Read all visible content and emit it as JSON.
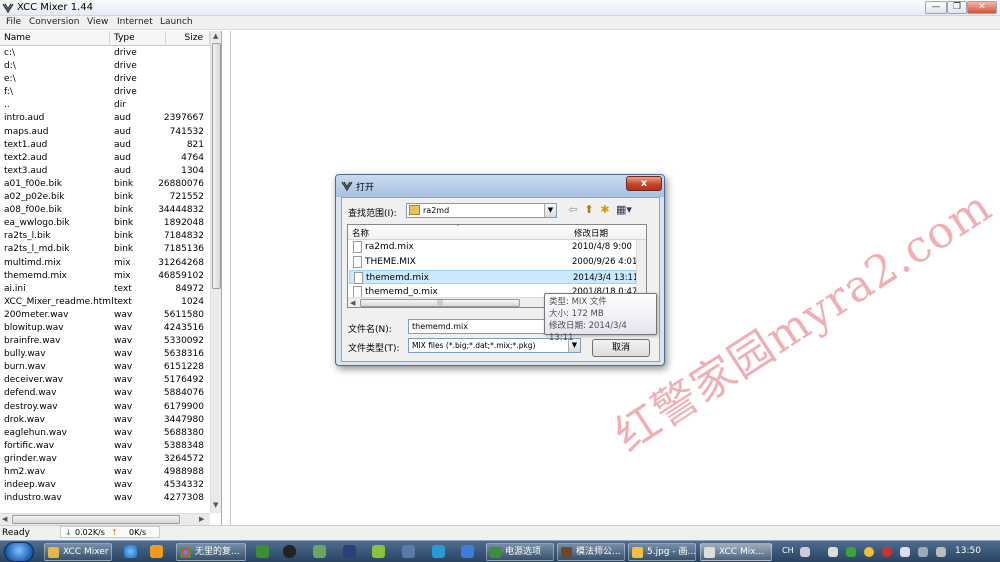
{
  "app": {
    "title": "XCC Mixer 1.44"
  },
  "window_controls": {
    "minimize": "—",
    "restore": "❐",
    "close": "✕"
  },
  "menu": [
    "File",
    "Conversion",
    "View",
    "Internet",
    "Launch"
  ],
  "list": {
    "headers": {
      "name": "Name",
      "type": "Type",
      "size": "Size"
    },
    "rows": [
      {
        "name": "c:\\",
        "type": "drive",
        "size": ""
      },
      {
        "name": "d:\\",
        "type": "drive",
        "size": ""
      },
      {
        "name": "e:\\",
        "type": "drive",
        "size": ""
      },
      {
        "name": "f:\\",
        "type": "drive",
        "size": ""
      },
      {
        "name": "..",
        "type": "dir",
        "size": ""
      },
      {
        "name": "intro.aud",
        "type": "aud",
        "size": "2397667"
      },
      {
        "name": "maps.aud",
        "type": "aud",
        "size": "741532"
      },
      {
        "name": "text1.aud",
        "type": "aud",
        "size": "821"
      },
      {
        "name": "text2.aud",
        "type": "aud",
        "size": "4764"
      },
      {
        "name": "text3.aud",
        "type": "aud",
        "size": "1304"
      },
      {
        "name": "a01_f00e.bik",
        "type": "bink",
        "size": "26880076"
      },
      {
        "name": "a02_p02e.bik",
        "type": "bink",
        "size": "721552"
      },
      {
        "name": "a08_f00e.bik",
        "type": "bink",
        "size": "34444832"
      },
      {
        "name": "ea_wwlogo.bik",
        "type": "bink",
        "size": "1892048"
      },
      {
        "name": "ra2ts_l.bik",
        "type": "bink",
        "size": "7184832"
      },
      {
        "name": "ra2ts_l_md.bik",
        "type": "bink",
        "size": "7185136"
      },
      {
        "name": "multimd.mix",
        "type": "mix",
        "size": "31264268"
      },
      {
        "name": "thememd.mix",
        "type": "mix",
        "size": "46859102"
      },
      {
        "name": "ai.ini",
        "type": "text",
        "size": "84972"
      },
      {
        "name": "XCC_Mixer_readme.html",
        "type": "text",
        "size": "1024"
      },
      {
        "name": "200meter.wav",
        "type": "wav",
        "size": "5611580"
      },
      {
        "name": "blowitup.wav",
        "type": "wav",
        "size": "4243516"
      },
      {
        "name": "brainfre.wav",
        "type": "wav",
        "size": "5330092"
      },
      {
        "name": "bully.wav",
        "type": "wav",
        "size": "5638316"
      },
      {
        "name": "burn.wav",
        "type": "wav",
        "size": "6151228"
      },
      {
        "name": "deceiver.wav",
        "type": "wav",
        "size": "5176492"
      },
      {
        "name": "defend.wav",
        "type": "wav",
        "size": "5884076"
      },
      {
        "name": "destroy.wav",
        "type": "wav",
        "size": "6179900"
      },
      {
        "name": "drok.wav",
        "type": "wav",
        "size": "3447980"
      },
      {
        "name": "eaglehun.wav",
        "type": "wav",
        "size": "5688380"
      },
      {
        "name": "fortific.wav",
        "type": "wav",
        "size": "5388348"
      },
      {
        "name": "grinder.wav",
        "type": "wav",
        "size": "3264572"
      },
      {
        "name": "hm2.wav",
        "type": "wav",
        "size": "4988988"
      },
      {
        "name": "indeep.wav",
        "type": "wav",
        "size": "4534332"
      },
      {
        "name": "industro.wav",
        "type": "wav",
        "size": "4277308"
      }
    ]
  },
  "status": {
    "text": "Ready",
    "down": "0.02K/s",
    "up": "0K/s"
  },
  "dialog": {
    "title": "打开",
    "close": "x",
    "lookin_label": "查找范围(I):",
    "lookin_value": "ra2md",
    "col_name": "名称",
    "col_date": "修改日期",
    "files": [
      {
        "name": "ra2md.mix",
        "date": "2010/4/8 9:00"
      },
      {
        "name": "THEME.MIX",
        "date": "2000/9/26 4:01"
      },
      {
        "name": "thememd.mix",
        "date": "2014/3/4 13:11"
      },
      {
        "name": "thememd_o.mix",
        "date": "2001/8/18 0:47"
      }
    ],
    "filename_label": "文件名(N):",
    "filename_value": "thememd.mix",
    "filetype_label": "文件类型(T):",
    "filetype_value": "MIX files (*.big;*.dat;*.mix;*.pkg)",
    "cancel": "取消"
  },
  "tooltip": {
    "line1": "类型: MIX 文件",
    "line2": "大小: 172 MB",
    "line3": "修改日期: 2014/3/4 13:11"
  },
  "watermark": "红警家园myra2.com",
  "taskbar": {
    "buttons": [
      "XCC Mixer",
      "无里的复...",
      "电源选项",
      "模法师公...",
      "5.jpg - 画...",
      "XCC Mix..."
    ],
    "lang": "CH",
    "clock": "13:50"
  }
}
